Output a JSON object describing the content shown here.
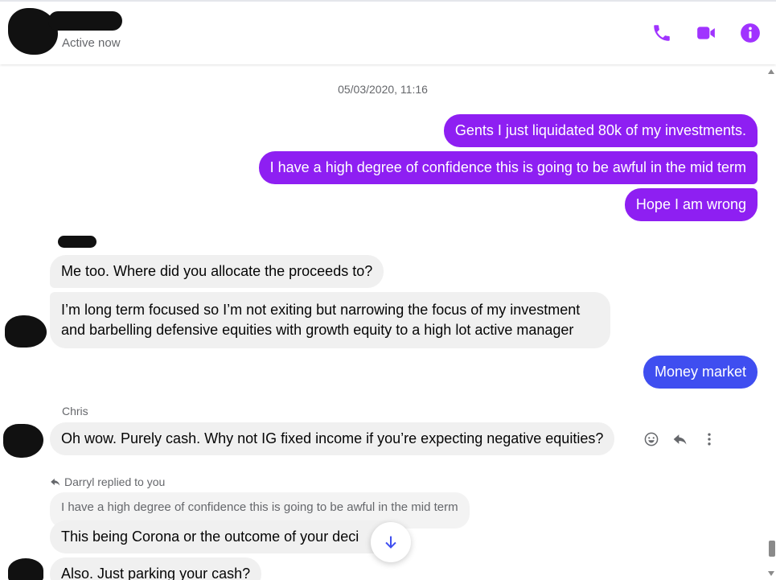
{
  "header": {
    "status": "Active now"
  },
  "colors": {
    "accent": "#a033ff",
    "outgoing_bubble": "#8e1ff2",
    "outgoing_bubble_alt": "#3f4ef0",
    "incoming_bubble": "#f0f0f0"
  },
  "icons": {
    "call": "phone-icon",
    "video": "video-camera-icon",
    "info": "info-icon",
    "react": "smiley-icon",
    "reply": "reply-arrow-icon",
    "more": "more-vertical-icon",
    "scroll_down": "arrow-down-icon"
  },
  "conversation": {
    "timestamp": "05/03/2020, 11:16",
    "outgoing_1": "Gents I just liquidated 80k of my investments.",
    "outgoing_2": "I have a high degree of confidence this is going to be awful in the mid term",
    "outgoing_3": "Hope I am wrong",
    "incoming_1": "Me too. Where did you allocate the proceeds to?",
    "incoming_2_line1": "I’m long term focused so I’m not exiting but narrowing the focus of my investment",
    "incoming_2_line2": "and barbelling defensive equities with growth equity to a high lot active manager",
    "outgoing_4": "Money market",
    "chris_name": "Chris",
    "chris_msg": "Oh wow. Purely cash. Why not IG fixed income if you’re expecting negative equities?",
    "reply_note": "Darryl replied to you",
    "quoted": "I have a high degree of confidence this is going to be awful in the mid term",
    "darryl_msg_1": "This being Corona or the outcome of your deci",
    "darryl_msg_2": "Also. Just parking your cash?"
  }
}
